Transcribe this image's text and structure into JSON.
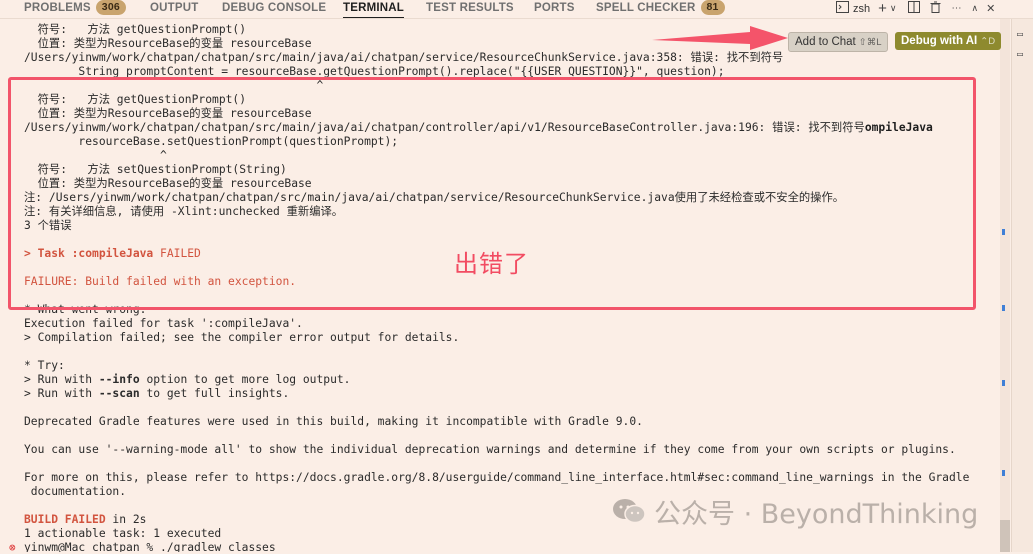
{
  "tabs": [
    {
      "label": "PROBLEMS",
      "badge": "306"
    },
    {
      "label": "OUTPUT",
      "badge": ""
    },
    {
      "label": "DEBUG CONSOLE",
      "badge": ""
    },
    {
      "label": "TERMINAL",
      "badge": "",
      "active": true
    },
    {
      "label": "TEST RESULTS",
      "badge": ""
    },
    {
      "label": "PORTS",
      "badge": ""
    },
    {
      "label": "SPELL CHECKER",
      "badge": "81"
    }
  ],
  "toolbar": {
    "shell_label": "zsh",
    "add_chat": "Add to Chat",
    "add_chat_kbd": "⇧⌘L",
    "debug_ai": "Debug with AI",
    "debug_ai_kbd": "⌃D"
  },
  "terminal_lines": [
    {
      "text": "  符号:   方法 getQuestionPrompt()",
      "style": ""
    },
    {
      "text": "  位置: 类型为ResourceBase的变量 resourceBase",
      "style": ""
    },
    {
      "text": "/Users/yinwm/work/chatpan/chatpan/src/main/java/ai/chatpan/service/ResourceChunkService.java:358: 错误: 找不到符号",
      "style": ""
    },
    {
      "text": "        String promptContent = resourceBase.getQuestionPrompt().replace(\"{{USER_QUESTION}}\", question);",
      "style": ""
    },
    {
      "text": "                                           ^",
      "style": ""
    },
    {
      "text": "  符号:   方法 getQuestionPrompt()",
      "style": ""
    },
    {
      "text": "  位置: 类型为ResourceBase的变量 resourceBase",
      "style": ""
    },
    {
      "text": "/Users/yinwm/work/chatpan/chatpan/src/main/java/ai/chatpan/controller/api/v1/ResourceBaseController.java:196: 错误: 找不到符号",
      "style": "",
      "tail": "ompileJava"
    },
    {
      "text": "        resourceBase.setQuestionPrompt(questionPrompt);",
      "style": ""
    },
    {
      "text": "                    ^",
      "style": ""
    },
    {
      "text": "  符号:   方法 setQuestionPrompt(String)",
      "style": ""
    },
    {
      "text": "  位置: 类型为ResourceBase的变量 resourceBase",
      "style": ""
    },
    {
      "text": "注: /Users/yinwm/work/chatpan/chatpan/src/main/java/ai/chatpan/service/ResourceChunkService.java使用了未经检查或不安全的操作。",
      "style": ""
    },
    {
      "text": "注: 有关详细信息, 请使用 -Xlint:unchecked 重新编译。",
      "style": ""
    },
    {
      "text": "3 个错误",
      "style": ""
    },
    {
      "text": "",
      "style": ""
    },
    {
      "text": "> Task :compileJava FAILED",
      "style": "task"
    },
    {
      "text": "",
      "style": ""
    },
    {
      "text": "FAILURE: Build failed with an exception.",
      "style": "red"
    },
    {
      "text": "",
      "style": ""
    },
    {
      "text": "* What went wrong:",
      "style": ""
    },
    {
      "text": "Execution failed for task ':compileJava'.",
      "style": ""
    },
    {
      "text": "> Compilation failed; see the compiler error output for details.",
      "style": ""
    },
    {
      "text": "",
      "style": ""
    },
    {
      "text": "* Try:",
      "style": ""
    },
    {
      "text": "> Run with --info option to get more log output.",
      "style": "info"
    },
    {
      "text": "> Run with --scan to get full insights.",
      "style": "scan"
    },
    {
      "text": "",
      "style": ""
    },
    {
      "text": "Deprecated Gradle features were used in this build, making it incompatible with Gradle 9.0.",
      "style": ""
    },
    {
      "text": "",
      "style": ""
    },
    {
      "text": "You can use '--warning-mode all' to show the individual deprecation warnings and determine if they come from your own scripts or plugins.",
      "style": ""
    },
    {
      "text": "",
      "style": ""
    },
    {
      "text": "For more on this, please refer to https://docs.gradle.org/8.8/userguide/command_line_interface.html#sec:command_line_warnings in the Gradle",
      "style": ""
    },
    {
      "text": " documentation.",
      "style": ""
    },
    {
      "text": "",
      "style": ""
    },
    {
      "text": "BUILD FAILED in 2s",
      "style": "buildfail"
    },
    {
      "text": "1 actionable task: 1 executed",
      "style": ""
    },
    {
      "text": "yinwm@Mac chatpan % ./gradlew classes",
      "style": "prompt"
    }
  ],
  "annotation": {
    "text": "出错了",
    "color": "#f24c62"
  },
  "watermark": {
    "text": "公众号 · BeyondThinking"
  },
  "colors": {
    "background": "#fbeee6",
    "error": "#d2543f",
    "annotation": "#f2546a"
  }
}
